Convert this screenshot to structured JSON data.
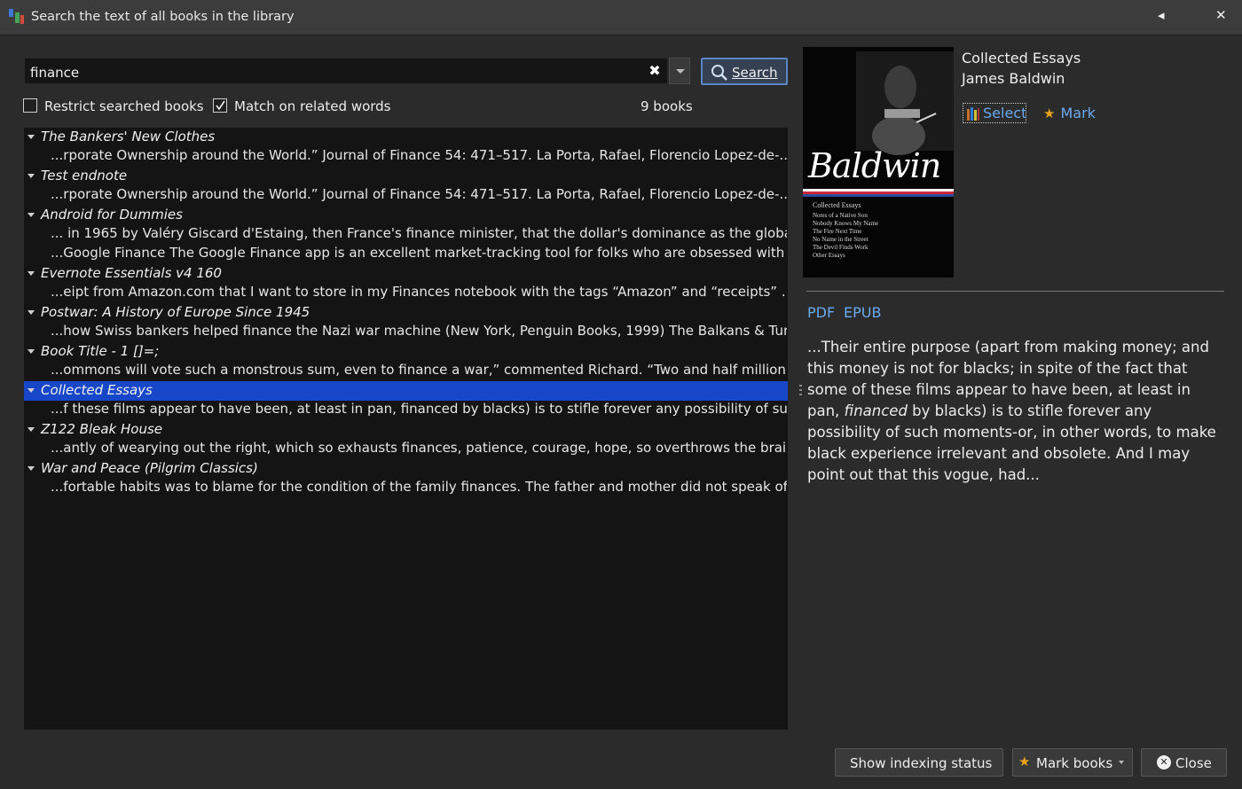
{
  "window": {
    "title": "Search the text of all books in the library"
  },
  "search": {
    "query": "finance",
    "button_label": "Search",
    "placeholder": ""
  },
  "options": {
    "restrict_label": "Restrict searched books",
    "restrict_checked": false,
    "match_related_label": "Match on related words",
    "match_related_checked": true,
    "count_text": "9 books"
  },
  "results": [
    {
      "title": "The Bankers' New Clothes",
      "selected": false,
      "snippets": [
        "...rporate Ownership around the World.” Journal of Finance 54: 471–517. La Porta, Rafael, Florencio Lopez-de-..."
      ]
    },
    {
      "title": "Test endnote",
      "selected": false,
      "snippets": [
        "...rporate Ownership around the World.” Journal of Finance 54: 471–517. La Porta, Rafael, Florencio Lopez-de-..."
      ]
    },
    {
      "title": "Android for Dummies",
      "selected": false,
      "snippets": [
        "... in 1965 by Valéry Giscard d'Estaing, then France's finance minister, that the dollar's dominance as the global...",
        "...Google Finance The Google Finance app is an excellent market-tracking tool for folks who are obsessed with ..."
      ]
    },
    {
      "title": "Evernote Essentials v4 160",
      "selected": false,
      "snippets": [
        "...eipt from Amazon.com that I want to store in my Finances notebook with the tags “Amazon” and “receipts” ..."
      ]
    },
    {
      "title": "Postwar: A History of Europe Since 1945",
      "selected": false,
      "snippets": [
        "...how Swiss bankers helped finance the Nazi war machine (New York, Penguin Books, 1999) The Balkans & Turk..."
      ]
    },
    {
      "title": "Book Title - 1 []=;",
      "selected": false,
      "snippets": [
        "...ommons will vote such a monstrous sum, even to finance a war,” commented Richard. “Two and half million..."
      ]
    },
    {
      "title": "Collected Essays",
      "selected": true,
      "snippets": [
        "...f these films appear to have been, at least in pan, financed by blacks) is to stifle forever any possibility of suc..."
      ]
    },
    {
      "title": "Z122 Bleak House",
      "selected": false,
      "snippets": [
        "...antly of wearying out the right, which so exhausts finances, patience, courage, hope, so overthrows the brain..."
      ]
    },
    {
      "title": "War and Peace (Pilgrim Classics)",
      "selected": false,
      "snippets": [
        "...fortable habits was to blame for the condition of the family finances. The father and mother did not speak of..."
      ]
    }
  ],
  "details": {
    "book_title": "Collected Essays",
    "author": "James Baldwin",
    "select_label": "Select",
    "mark_label": "Mark",
    "formats": [
      "PDF",
      "EPUB"
    ],
    "preview_before": "...Their entire purpose (apart from making money; and this money is not for blacks; in spite of the fact that some of these films appear to have been, at least in pan, ",
    "preview_match": "financed",
    "preview_after": " by blacks) is to stifle forever any possibility of such moments-or, in other words, to make black experience irrelevant and obsolete. And I may point out that this vogue, had...",
    "cover": {
      "author_script": "Baldwin",
      "series_title": "Collected Essays",
      "contents": [
        "Notes of a Native Son",
        "Nobody Knows My Name",
        "The Fire Next Time",
        "No Name in the Street",
        "The Devil Finds Work",
        "Other Essays"
      ]
    }
  },
  "footer": {
    "indexing_label": "Show indexing status",
    "mark_books_label": "Mark books",
    "close_label": "Close"
  },
  "colors": {
    "accent": "#5b86c4",
    "link": "#6aa9ee",
    "selection": "#1846c8",
    "star": "#e8a21c"
  }
}
